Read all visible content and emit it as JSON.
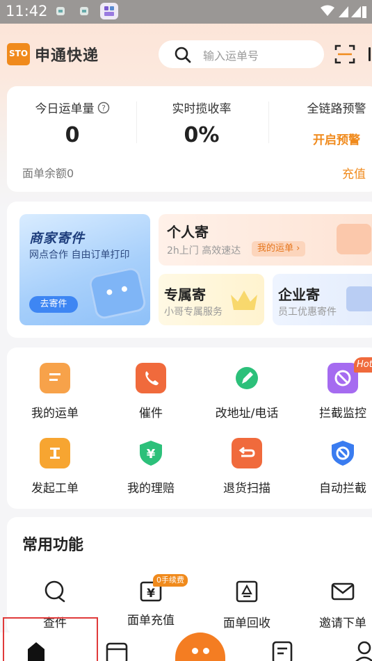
{
  "status_bar": {
    "time": "11:42"
  },
  "header": {
    "logo_text": "STO",
    "brand_name": "申通快递",
    "search_placeholder": "输入运单号"
  },
  "stats": {
    "today_orders_label": "今日运单量",
    "today_orders_value": "0",
    "pickup_rate_label": "实时揽收率",
    "pickup_rate_value": "0%",
    "chain_alert_label": "全链路预警",
    "open_alert_label": "开启预警",
    "balance_label": "面单余额0",
    "recharge_label": "充值"
  },
  "shipping": {
    "merchant": {
      "title": "商家寄件",
      "subtitle": "网点合作 自由订单打印",
      "button": "去寄件"
    },
    "personal": {
      "title": "个人寄",
      "subtitle": "2h上门 高效速达",
      "pill": "我的运单 ›"
    },
    "exclusive": {
      "title": "专属寄",
      "subtitle": "小哥专属服务"
    },
    "enterprise": {
      "title": "企业寄",
      "subtitle": "员工优惠寄件"
    }
  },
  "features": [
    {
      "label": "我的运单",
      "icon": "waybill-icon",
      "color": "#f7a24a"
    },
    {
      "label": "催件",
      "icon": "phone-icon",
      "color": "#f06a3c"
    },
    {
      "label": "改地址/电话",
      "icon": "edit-pen-icon",
      "color": "#2cc07a"
    },
    {
      "label": "拦截监控",
      "icon": "intercept-monitor-icon",
      "color": "#a56bf0",
      "badge": "Hot"
    },
    {
      "label": "发起工单",
      "icon": "work-order-icon",
      "color": "#f7a531"
    },
    {
      "label": "我的理赔",
      "icon": "claim-icon",
      "color": "#2cc07a"
    },
    {
      "label": "退货扫描",
      "icon": "return-scan-icon",
      "color": "#f06a3c"
    },
    {
      "label": "自动拦截",
      "icon": "auto-intercept-icon",
      "color": "#3a7cf0"
    }
  ],
  "common": {
    "title": "常用功能",
    "items": [
      {
        "label": "查件",
        "icon": "search-chat-icon"
      },
      {
        "label": "面单充值",
        "icon": "recharge-icon",
        "badge": "0手续费"
      },
      {
        "label": "面单回收",
        "icon": "recycle-icon"
      },
      {
        "label": "邀请下单",
        "icon": "mail-icon"
      }
    ]
  },
  "colors": {
    "accent": "#f08a1c",
    "highlight_frame": "#e03a3a"
  }
}
